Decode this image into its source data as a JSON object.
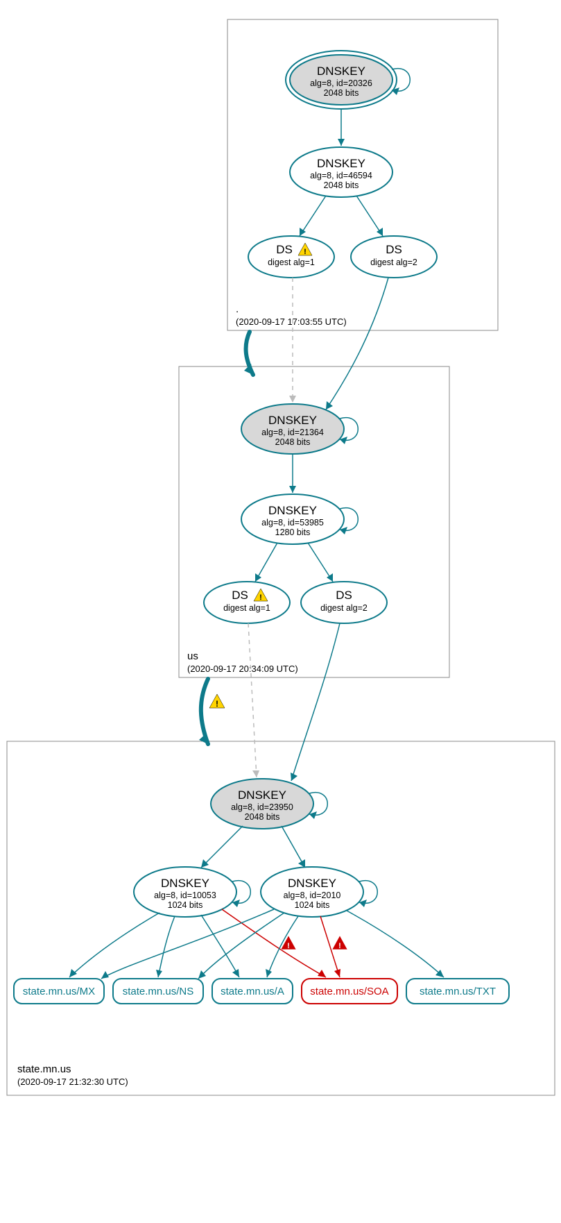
{
  "zones": {
    "root": {
      "name": ".",
      "timestamp": "(2020-09-17 17:03:55 UTC)"
    },
    "us": {
      "name": "us",
      "timestamp": "(2020-09-17 20:34:09 UTC)"
    },
    "state": {
      "name": "state.mn.us",
      "timestamp": "(2020-09-17 21:32:30 UTC)"
    }
  },
  "nodes": {
    "rootKSK": {
      "title": "DNSKEY",
      "l1": "alg=8, id=20326",
      "l2": "2048 bits"
    },
    "rootZSK": {
      "title": "DNSKEY",
      "l1": "alg=8, id=46594",
      "l2": "2048 bits"
    },
    "rootDS1": {
      "title": "DS",
      "l1": "digest alg=1"
    },
    "rootDS2": {
      "title": "DS",
      "l1": "digest alg=2"
    },
    "usKSK": {
      "title": "DNSKEY",
      "l1": "alg=8, id=21364",
      "l2": "2048 bits"
    },
    "usZSK": {
      "title": "DNSKEY",
      "l1": "alg=8, id=53985",
      "l2": "1280 bits"
    },
    "usDS1": {
      "title": "DS",
      "l1": "digest alg=1"
    },
    "usDS2": {
      "title": "DS",
      "l1": "digest alg=2"
    },
    "stKSK": {
      "title": "DNSKEY",
      "l1": "alg=8, id=23950",
      "l2": "2048 bits"
    },
    "stZSK1": {
      "title": "DNSKEY",
      "l1": "alg=8, id=10053",
      "l2": "1024 bits"
    },
    "stZSK2": {
      "title": "DNSKEY",
      "l1": "alg=8, id=2010",
      "l2": "1024 bits"
    }
  },
  "rr": {
    "mx": "state.mn.us/MX",
    "ns": "state.mn.us/NS",
    "a": "state.mn.us/A",
    "soa": "state.mn.us/SOA",
    "txt": "state.mn.us/TXT"
  }
}
